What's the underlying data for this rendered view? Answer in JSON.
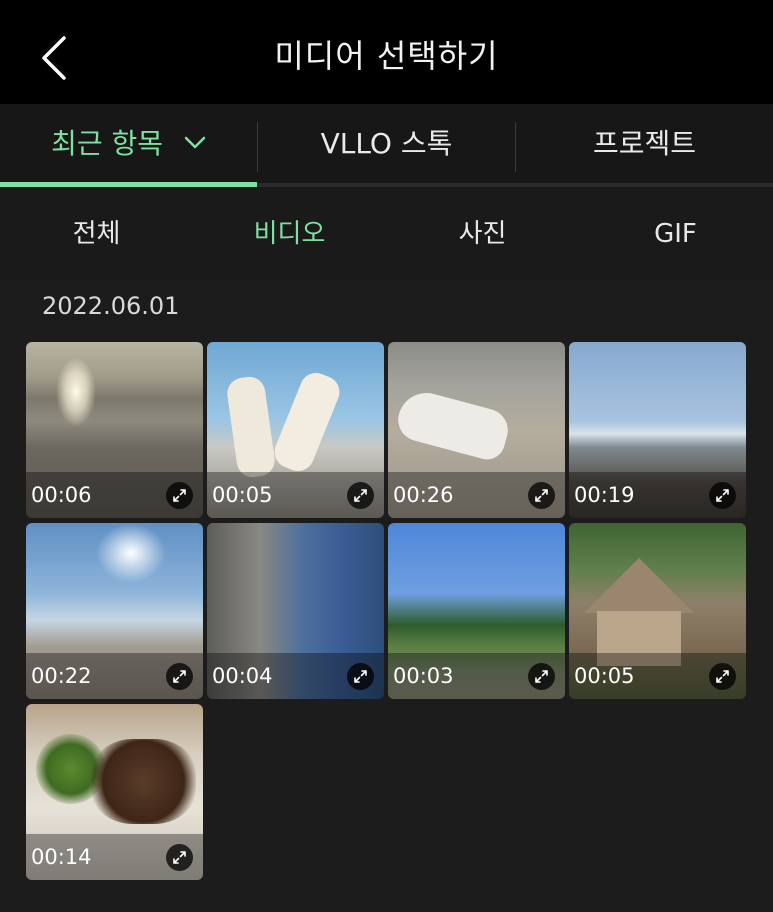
{
  "header": {
    "title": "미디어 선택하기",
    "back_icon": "chevron-left-icon"
  },
  "tabs": [
    {
      "label": "최근 항목",
      "active": true,
      "has_dropdown": true
    },
    {
      "label": "VLLO 스톡",
      "active": false
    },
    {
      "label": "프로젝트",
      "active": false
    }
  ],
  "filters": [
    {
      "label": "전체",
      "active": false
    },
    {
      "label": "비디오",
      "active": true
    },
    {
      "label": "사진",
      "active": false
    },
    {
      "label": "GIF",
      "active": false
    }
  ],
  "section": {
    "date": "2022.06.01"
  },
  "media": [
    {
      "duration": "00:06",
      "scene": "beach-heart"
    },
    {
      "duration": "00:05",
      "scene": "popsicles"
    },
    {
      "duration": "00:26",
      "scene": "sleeping-dog"
    },
    {
      "duration": "00:19",
      "scene": "sea-horizon"
    },
    {
      "duration": "00:22",
      "scene": "beach-sun"
    },
    {
      "duration": "00:04",
      "scene": "rocks-ladder"
    },
    {
      "duration": "00:03",
      "scene": "field-trees"
    },
    {
      "duration": "00:05",
      "scene": "straw-hut"
    },
    {
      "duration": "00:14",
      "scene": "food-plate"
    }
  ],
  "colors": {
    "accent": "#7ee0a1",
    "background": "#1c1c1c",
    "header": "#000000"
  }
}
